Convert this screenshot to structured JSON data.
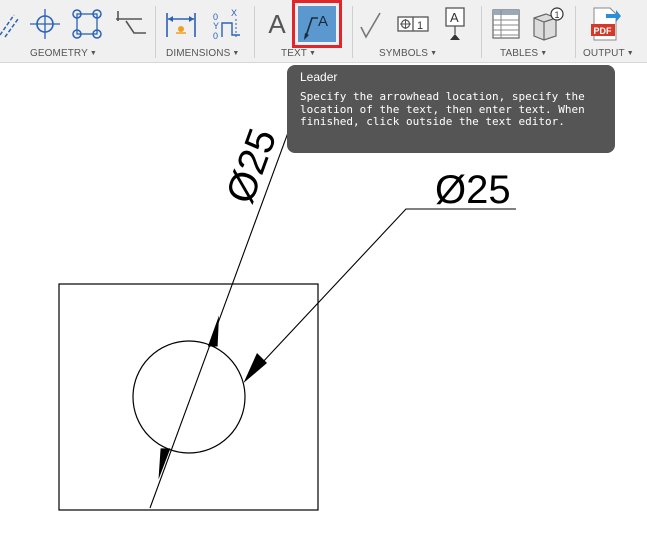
{
  "toolbar": {
    "groups": [
      {
        "label": "GEOMETRY",
        "caret": "▼"
      },
      {
        "label": "DIMENSIONS",
        "caret": "▼"
      },
      {
        "label": "TEXT",
        "caret": "▼"
      },
      {
        "label": "SYMBOLS",
        "caret": "▼"
      },
      {
        "label": "TABLES",
        "caret": "▼"
      },
      {
        "label": "OUTPUT",
        "caret": "▼"
      }
    ],
    "icons": {
      "text": "A",
      "leader": "A",
      "symbol_feature_control": "⊕1",
      "symbol_datum": "A",
      "balloon": "1",
      "pdf": "PDF"
    },
    "active_tool": "leader"
  },
  "tooltip": {
    "title": "Leader",
    "description": "Specify the arrowhead location, specify the location of the text, then enter text. When finished, click outside the text editor."
  },
  "drawing": {
    "diameter_label_rotated": "Ø25",
    "diameter_label_leader": "Ø25"
  },
  "colors": {
    "toolbar_bg": "#f0f0f0",
    "active_tool_bg": "#5b98cf",
    "active_tool_border": "#e0262b",
    "tooltip_bg": "#555555",
    "icon_blue": "#2a62b5",
    "pdf_red": "#d23a2a"
  }
}
